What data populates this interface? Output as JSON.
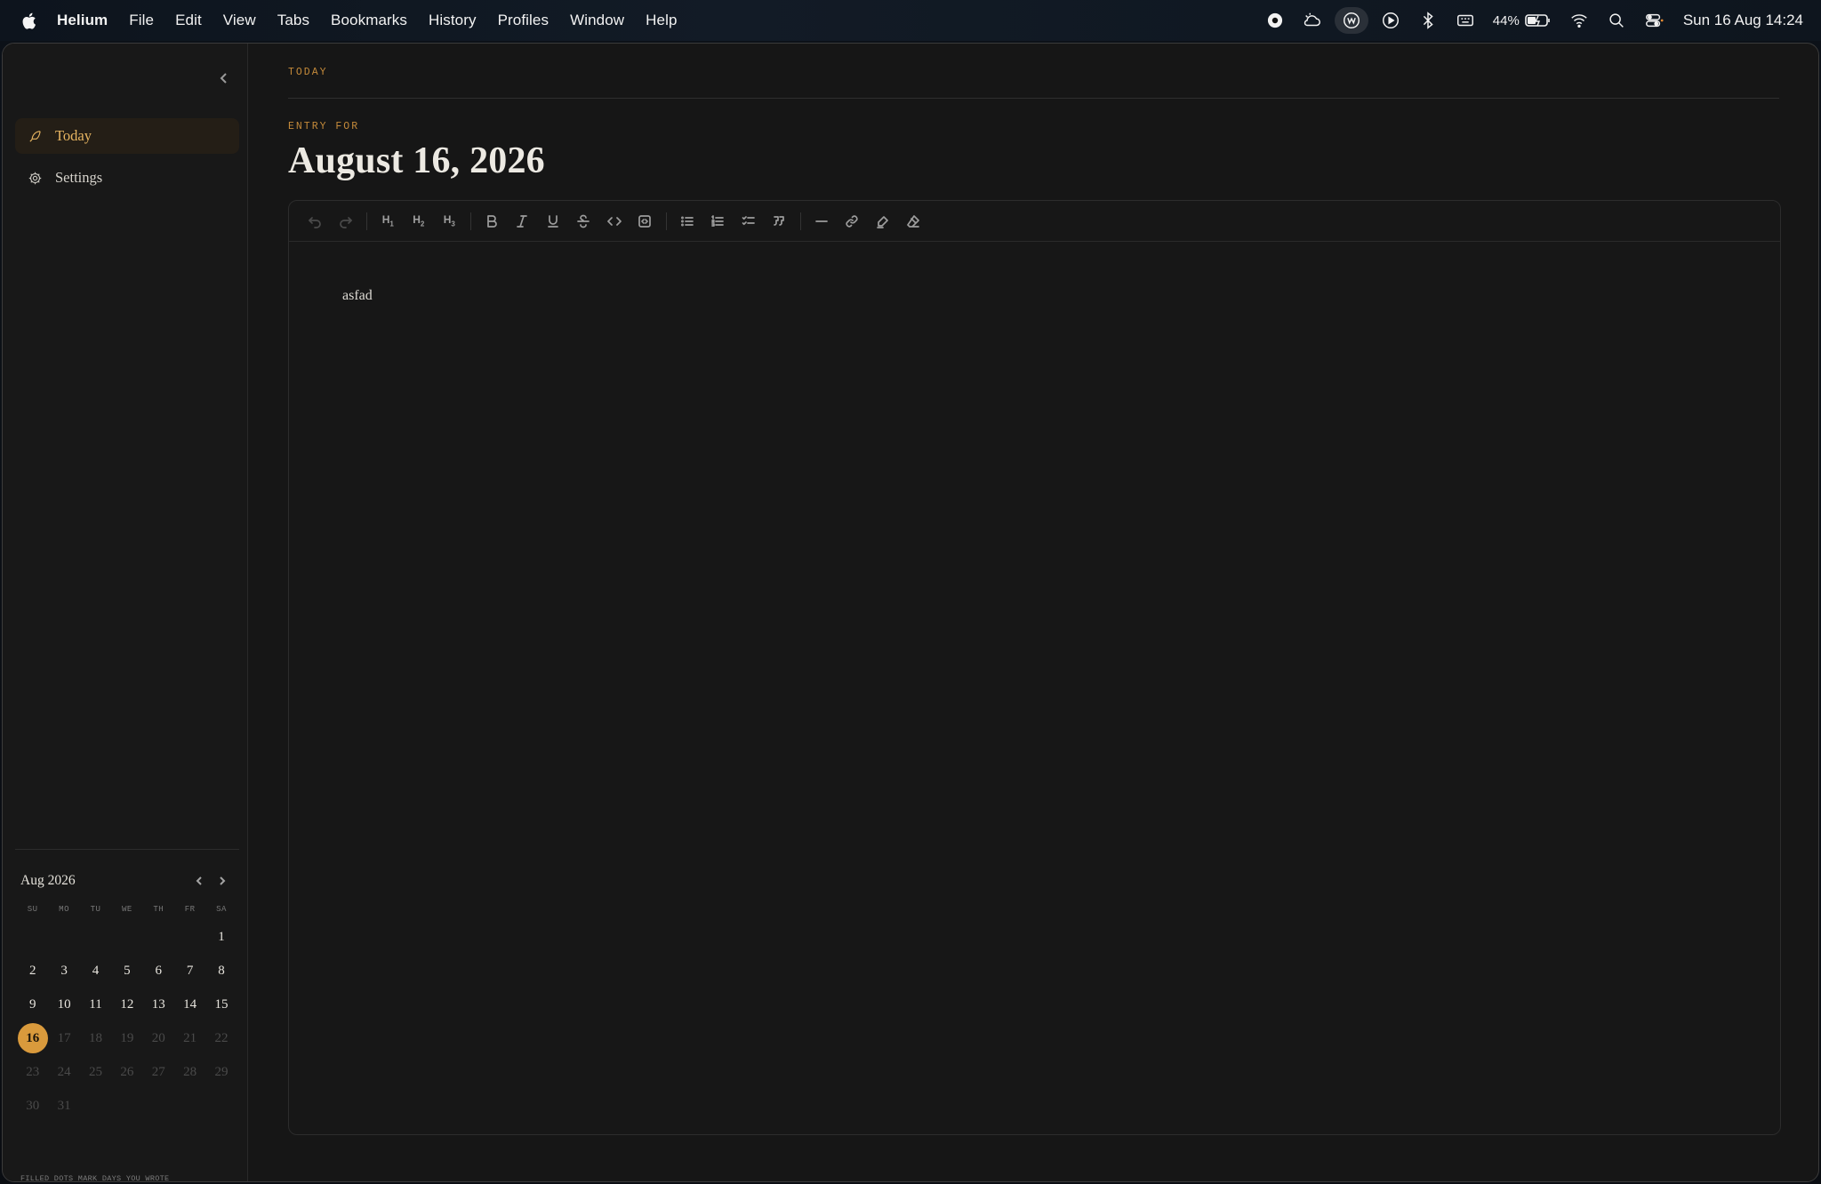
{
  "menubar": {
    "app_name": "Helium",
    "items": [
      "File",
      "Edit",
      "View",
      "Tabs",
      "Bookmarks",
      "History",
      "Profiles",
      "Window",
      "Help"
    ],
    "battery_percent": "44%",
    "clock": "Sun 16 Aug  14:24",
    "status_icons": [
      "record-icon",
      "cloud-weather-icon",
      "w-badge-icon",
      "play-icon",
      "bluetooth-icon",
      "keyboard-icon",
      "battery-icon",
      "wifi-icon",
      "spotlight-search-icon",
      "control-center-icon"
    ]
  },
  "sidebar": {
    "nav": [
      {
        "label": "Today",
        "icon": "feather-icon",
        "active": true
      },
      {
        "label": "Settings",
        "icon": "gear-icon",
        "active": false
      }
    ],
    "calendar": {
      "month_label": "Aug 2026",
      "weekdays": [
        "SU",
        "MO",
        "TU",
        "WE",
        "TH",
        "FR",
        "SA"
      ],
      "leading_blanks": 6,
      "days": 31,
      "selected_day": 16,
      "footnote": "FILLED DOTS MARK DAYS YOU WROTE"
    }
  },
  "main": {
    "breadcrumb": "TODAY",
    "entry_label": "ENTRY FOR",
    "entry_date": "August 16, 2026",
    "toolbar": [
      "undo-icon",
      "redo-icon",
      "|",
      "h1",
      "h2",
      "h3",
      "|",
      "bold-icon",
      "italic-icon",
      "underline-icon",
      "strikethrough-icon",
      "code-icon",
      "code-block-icon",
      "|",
      "bullet-list-icon",
      "ordered-list-icon",
      "task-list-icon",
      "blockquote-icon",
      "|",
      "horizontal-rule-icon",
      "link-icon",
      "highlight-icon",
      "clear-format-icon"
    ],
    "editor_text": "asfad"
  },
  "colors": {
    "accent": "#d99a3c",
    "accent_text": "#c48a3a",
    "background": "#161616"
  }
}
